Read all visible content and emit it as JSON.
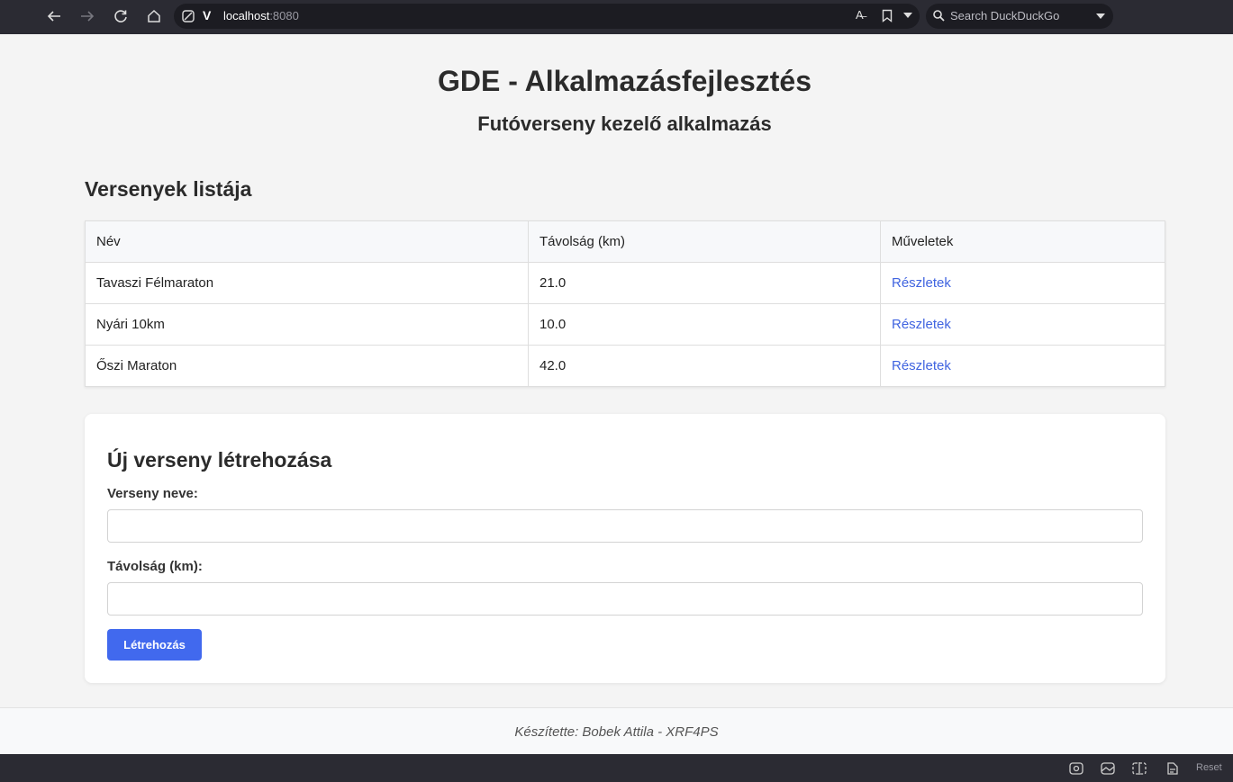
{
  "browser": {
    "url_host": "localhost",
    "url_port": ":8080",
    "logo": "V",
    "translate_glyph": "A̶",
    "search_placeholder": "Search DuckDuckGo",
    "status_reset": "Reset"
  },
  "page": {
    "title": "GDE - Alkalmazásfejlesztés",
    "subtitle": "Futóverseny kezelő alkalmazás"
  },
  "races": {
    "title": "Versenyek listája",
    "headers": [
      "Név",
      "Távolság (km)",
      "Műveletek"
    ],
    "rows": [
      {
        "name": "Tavaszi Félmaraton",
        "distance": "21.0",
        "action": "Részletek"
      },
      {
        "name": "Nyári 10km",
        "distance": "10.0",
        "action": "Részletek"
      },
      {
        "name": "Őszi Maraton",
        "distance": "42.0",
        "action": "Részletek"
      }
    ]
  },
  "form": {
    "title": "Új verseny létrehozása",
    "name_label": "Verseny neve:",
    "name_value": "",
    "distance_label": "Távolság (km):",
    "distance_value": "",
    "submit_label": "Létrehozás"
  },
  "footer": {
    "text": "Készítette: Bobek Attila - XRF4PS"
  }
}
